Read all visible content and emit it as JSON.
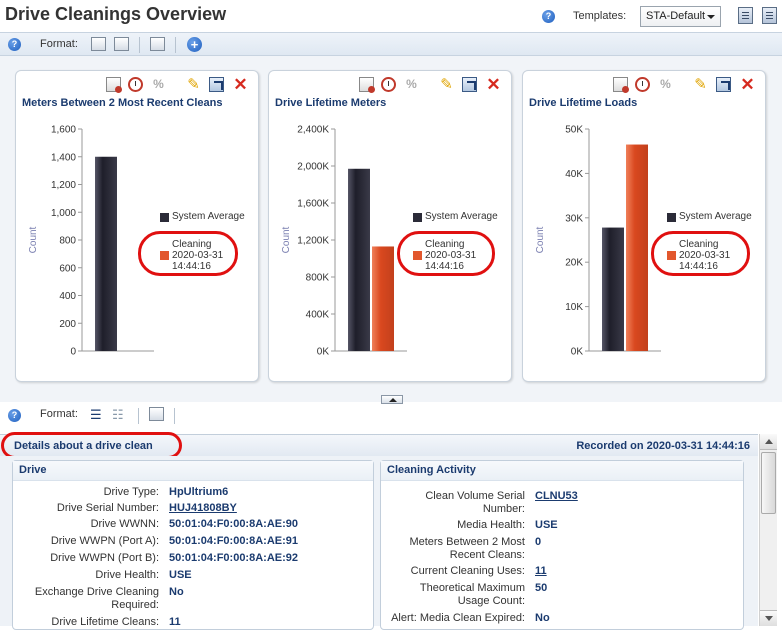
{
  "page": {
    "title": "Drive Cleanings Overview",
    "templates_label": "Templates:",
    "template_selected": "STA-Default"
  },
  "toolbar": {
    "format_label": "Format:"
  },
  "toolbar2": {
    "format_label": "Format:"
  },
  "colors": {
    "system_average": "#2b2b38",
    "cleaning": "#e2572d",
    "title_blue": "#1b3b6f",
    "highlight_oval": "#e01010"
  },
  "panels": [
    {
      "title": "Meters Between 2 Most Recent Cleans",
      "y_axis_label": "Count",
      "legend": {
        "system_average": "System Average",
        "cleaning_1": "Cleaning",
        "cleaning_2": "2020-03-31",
        "cleaning_3": "14:44:16"
      }
    },
    {
      "title": "Drive Lifetime Meters",
      "y_axis_label": "Count",
      "legend": {
        "system_average": "System Average",
        "cleaning_1": "Cleaning",
        "cleaning_2": "2020-03-31",
        "cleaning_3": "14:44:16"
      }
    },
    {
      "title": "Drive Lifetime Loads",
      "y_axis_label": "Count",
      "legend": {
        "system_average": "System Average",
        "cleaning_1": "Cleaning",
        "cleaning_2": "2020-03-31",
        "cleaning_3": "14:44:16"
      }
    }
  ],
  "chart_data": [
    {
      "type": "bar",
      "title": "Meters Between 2 Most Recent Cleans",
      "ylabel": "Count",
      "ylim": [
        0,
        1600
      ],
      "yticks": [
        0,
        200,
        400,
        600,
        800,
        1000,
        1200,
        1400,
        1600
      ],
      "ytick_labels": [
        "0",
        "200",
        "400",
        "600",
        "800",
        "1,000",
        "1,200",
        "1,400",
        "1,600"
      ],
      "series": [
        {
          "name": "System Average",
          "values": [
            1400
          ]
        },
        {
          "name": "Cleaning 2020-03-31 14:44:16",
          "values": [
            0
          ]
        }
      ]
    },
    {
      "type": "bar",
      "title": "Drive Lifetime Meters",
      "ylabel": "Count",
      "ylim": [
        0,
        2400000
      ],
      "yticks": [
        0,
        400000,
        800000,
        1200000,
        1600000,
        2000000,
        2400000
      ],
      "ytick_labels": [
        "0K",
        "400K",
        "800K",
        "1,200K",
        "1,600K",
        "2,000K",
        "2,400K"
      ],
      "series": [
        {
          "name": "System Average",
          "values": [
            1970000
          ]
        },
        {
          "name": "Cleaning 2020-03-31 14:44:16",
          "values": [
            1130000
          ]
        }
      ]
    },
    {
      "type": "bar",
      "title": "Drive Lifetime Loads",
      "ylabel": "Count",
      "ylim": [
        0,
        50000
      ],
      "yticks": [
        0,
        10000,
        20000,
        30000,
        40000,
        50000
      ],
      "ytick_labels": [
        "0K",
        "10K",
        "20K",
        "30K",
        "40K",
        "50K"
      ],
      "series": [
        {
          "name": "System Average",
          "values": [
            27800
          ]
        },
        {
          "name": "Cleaning 2020-03-31 14:44:16",
          "values": [
            46500
          ]
        }
      ]
    }
  ],
  "details": {
    "title": "Details about a drive clean",
    "recorded": "Recorded on 2020-03-31 14:44:16",
    "drive": {
      "title": "Drive",
      "rows": [
        {
          "label": "Drive Type:",
          "value": "HpUltrium6"
        },
        {
          "label": "Drive Serial Number:",
          "value": "HUJ41808BY"
        },
        {
          "label": "Drive WWNN:",
          "value": "50:01:04:F0:00:8A:AE:90"
        },
        {
          "label": "Drive WWPN (Port A):",
          "value": "50:01:04:F0:00:8A:AE:91"
        },
        {
          "label": "Drive WWPN (Port B):",
          "value": "50:01:04:F0:00:8A:AE:92"
        },
        {
          "label": "Drive Health:",
          "value": "USE"
        },
        {
          "label": "Exchange Drive Cleaning Required:",
          "value": "No"
        },
        {
          "label": "Drive Lifetime Cleans:",
          "value": "11"
        }
      ]
    },
    "cleaning": {
      "title": "Cleaning Activity",
      "rows": [
        {
          "label": "Clean Volume Serial Number:",
          "value": "CLNU53"
        },
        {
          "label": "Media Health:",
          "value": "USE"
        },
        {
          "label": "Meters Between 2 Most Recent Cleans:",
          "value": "0"
        },
        {
          "label": "Current Cleaning Uses:",
          "value": "11"
        },
        {
          "label": "Theoretical Maximum Usage Count:",
          "value": "50"
        },
        {
          "label": "Alert: Media Clean Expired:",
          "value": "No"
        }
      ]
    }
  }
}
